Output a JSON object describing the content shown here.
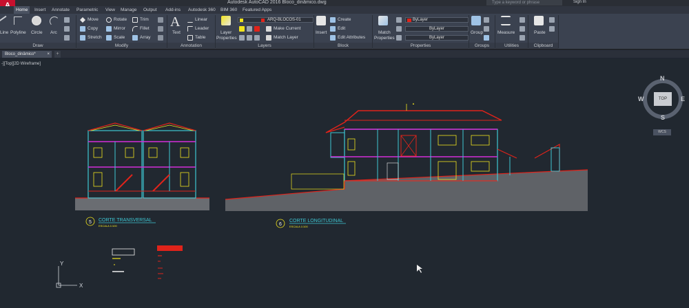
{
  "app": {
    "logo": "A",
    "title": "Autodesk AutoCAD 2016   Bloco_dinâmico.dwg",
    "search_placeholder": "Type a keyword or phrase",
    "signin": "Sign In"
  },
  "tabs": [
    "Home",
    "Insert",
    "Annotate",
    "Parametric",
    "View",
    "Manage",
    "Output",
    "Add-ins",
    "Autodesk 360",
    "BIM 360",
    "Featured Apps"
  ],
  "ribbon": {
    "draw": {
      "title": "Draw",
      "line": "Line",
      "polyline": "Polyline",
      "circle": "Circle",
      "arc": "Arc"
    },
    "modify": {
      "title": "Modify",
      "move": "Move",
      "rotate": "Rotate",
      "trim": "Trim",
      "copy": "Copy",
      "mirror": "Mirror",
      "fillet": "Fillet",
      "stretch": "Stretch",
      "scale": "Scale",
      "array": "Array"
    },
    "annotation": {
      "title": "Annotation",
      "text": "Text",
      "linear": "Linear",
      "leader": "Leader",
      "table": "Table"
    },
    "layers": {
      "title": "Layers",
      "layer_properties_1": "Layer",
      "layer_properties_2": "Properties",
      "current_layer": "ARQ-BLOCOS-01",
      "make_current": "Make Current",
      "match_layer": "Match Layer"
    },
    "block": {
      "title": "Block",
      "insert": "Insert",
      "create": "Create",
      "edit": "Edit",
      "edit_attributes": "Edit Attributes"
    },
    "properties": {
      "title": "Properties",
      "match_1": "Match",
      "match_2": "Properties",
      "color": "ByLayer",
      "linetype": "ByLayer",
      "lineweight": "ByLayer"
    },
    "groups": {
      "title": "Groups",
      "group": "Group"
    },
    "utilities": {
      "title": "Utilities",
      "measure": "Measure"
    },
    "clipboard": {
      "title": "Clipboard",
      "paste": "Paste"
    }
  },
  "file_tab": {
    "name": "Bloco_dinâmico*",
    "close": "×",
    "plus": "+"
  },
  "viewport": {
    "label": "-][Top][2D Wireframe]",
    "viewcube": {
      "n": "N",
      "s": "S",
      "e": "E",
      "w": "W",
      "top": "TOP",
      "wcs": "WCS"
    }
  },
  "drawing": {
    "corte5": {
      "number": "5",
      "title": "CORTE TRANSVERSAL",
      "scale": "ESCALA 1/100"
    },
    "corte6": {
      "number": "6",
      "title": "CORTE LONGITUDINAL",
      "scale": "ESCALA 1/100"
    },
    "ucs_x": "X",
    "ucs_y": "Y"
  },
  "colors": {
    "red": "#e0231a",
    "yellow": "#f2e41d",
    "magenta": "#d62dd9",
    "cyan": "#3ec7d4",
    "gray": "#8a8a8a",
    "white": "#f0f0f0"
  }
}
